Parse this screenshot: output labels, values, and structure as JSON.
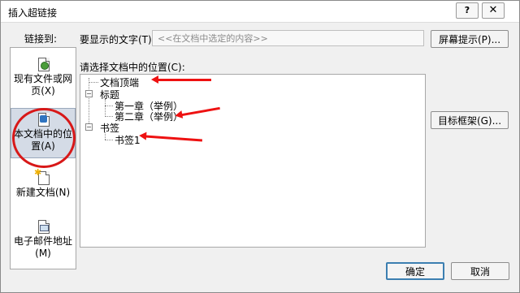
{
  "window": {
    "title": "插入超链接",
    "help_label": "?",
    "close_label": "✕"
  },
  "labels": {
    "link_to": "链接到:",
    "display_text": "要显示的文字(T):",
    "select_place": "请选择文档中的位置(C):"
  },
  "display_text_value": "<<在文档中选定的内容>>",
  "buttons": {
    "screentip": "屏幕提示(P)...",
    "target_frame": "目标框架(G)...",
    "ok": "确定",
    "cancel": "取消"
  },
  "sidebar": {
    "items": [
      {
        "label": "现有文件或网页(X)",
        "icon": "file-globe-icon",
        "selected": false
      },
      {
        "label": "本文档中的位置(A)",
        "icon": "document-place-icon",
        "selected": true
      },
      {
        "label": "新建文档(N)",
        "icon": "new-document-icon",
        "selected": false
      },
      {
        "label": "电子邮件地址(M)",
        "icon": "email-icon",
        "selected": false
      }
    ]
  },
  "tree": {
    "top": "文档顶端",
    "headings": {
      "label": "标题",
      "expander": "−",
      "children": [
        "第一章（举例）",
        "第二章（举例）"
      ]
    },
    "bookmarks": {
      "label": "书签",
      "expander": "−",
      "children": [
        "书签1"
      ]
    }
  },
  "annotation_color": "#e11111"
}
